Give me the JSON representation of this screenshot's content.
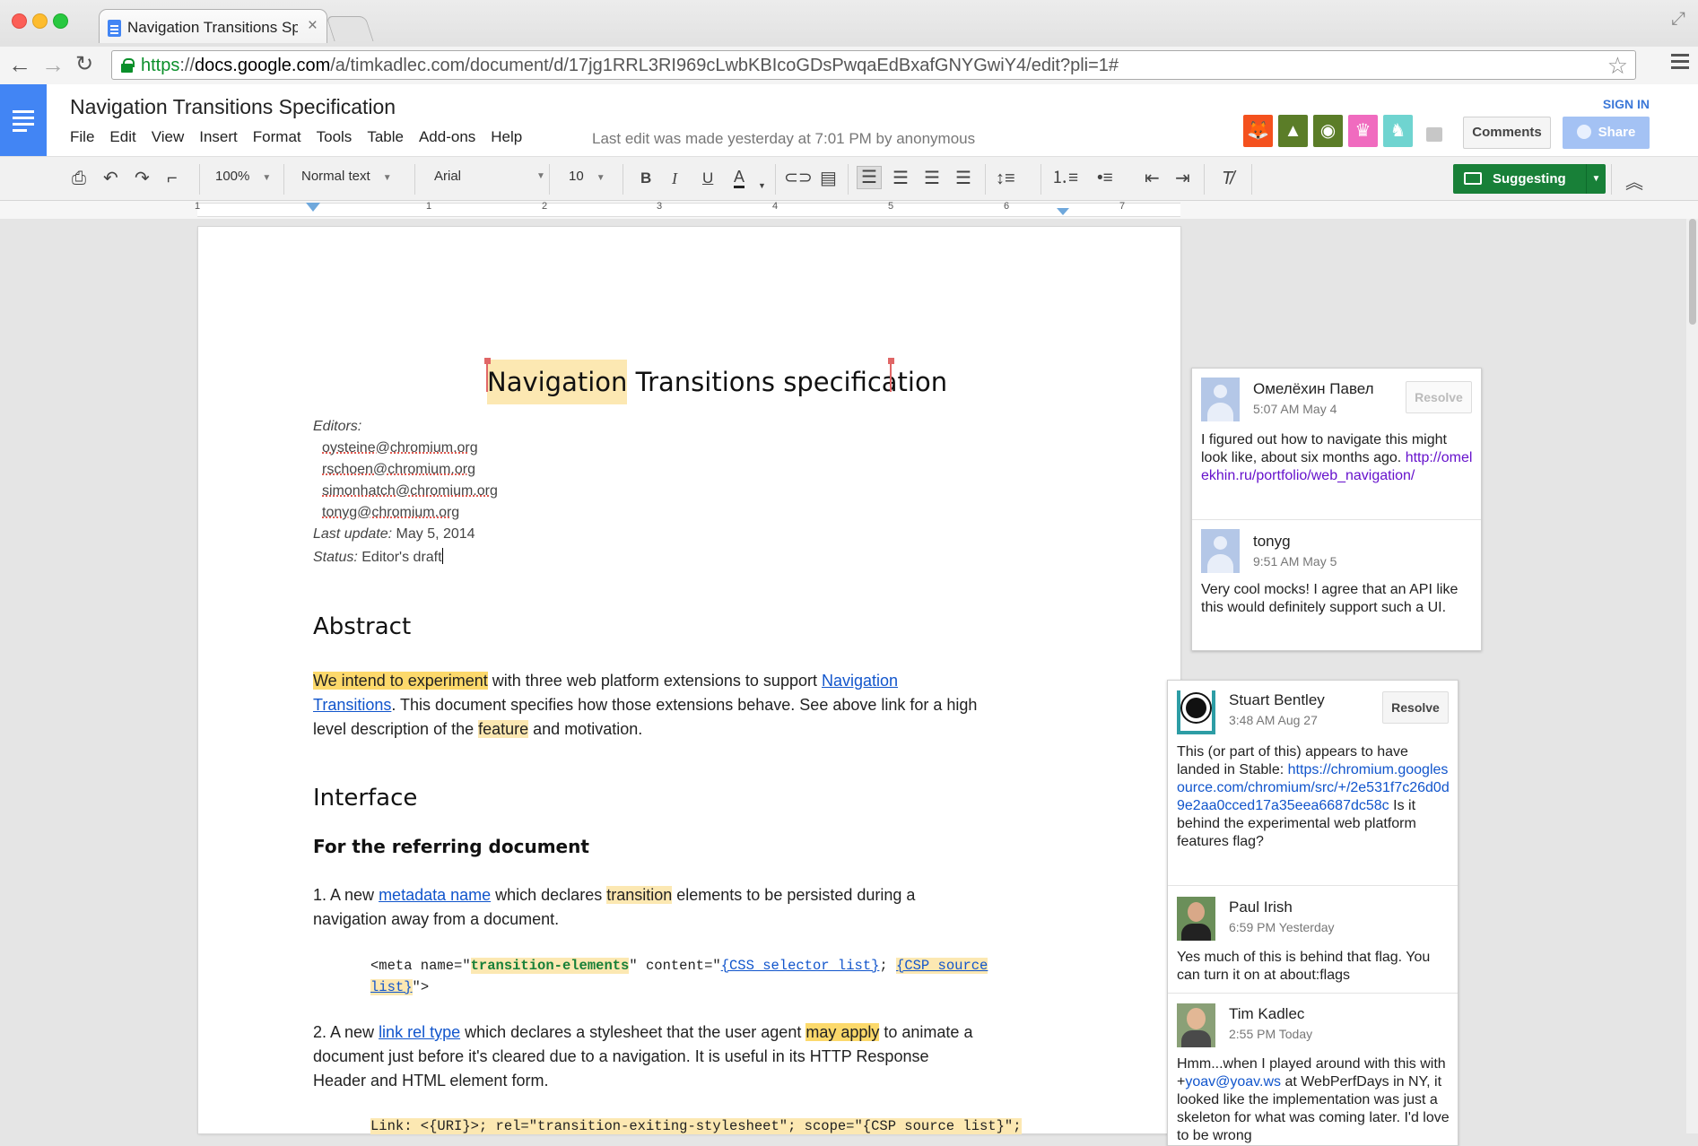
{
  "browser": {
    "tab_title": "Navigation Transitions Spe",
    "tab_close": "×",
    "url_scheme": "https",
    "url_host": "docs.google.com",
    "url_rest": "/a/timkadlec.com/document/d/17jg1RRL3RI969cLwbKBIcoGDsPwqaEdBxafGNYGwiY4/edit?pli=1#"
  },
  "docs": {
    "title": "Navigation Transitions Specification",
    "menu": [
      "File",
      "Edit",
      "View",
      "Insert",
      "Format",
      "Tools",
      "Table",
      "Add-ons",
      "Help"
    ],
    "last_edit": "Last edit was made yesterday at 7:01 PM by anonymous",
    "sign_in": "SIGN IN",
    "comments_label": "Comments",
    "share_label": "Share",
    "collaborator_colors": [
      "#f4511e",
      "#5b7d28",
      "#5b7d28",
      "#f06bbf",
      "#6fd4d0"
    ]
  },
  "toolbar": {
    "zoom": "100%",
    "style": "Normal text",
    "font": "Arial",
    "font_size": "10",
    "bold": "B",
    "italic": "I",
    "underline": "U",
    "text_color": "A",
    "suggesting_label": "Suggesting"
  },
  "ruler": {
    "numbers": [
      "1",
      "1",
      "2",
      "3",
      "4",
      "5",
      "6",
      "7"
    ]
  },
  "document": {
    "title_a": "Navigation",
    "title_b": " Transitions specification",
    "editors_label": "Editors:",
    "editors": [
      "oysteine@chromium.org",
      "rschoen@chromium.org",
      "simonhatch@chromium.org",
      "tonyg@chromium.org"
    ],
    "last_update_label": "Last update:",
    "last_update_value": " May 5, 2014",
    "status_label": "Status:",
    "status_value": " Editor's draft",
    "abstract_heading": "Abstract",
    "abstract_p1_hl": "We intend to experiment",
    "abstract_p1_a": " with three web platform extensions to support ",
    "abstract_p1_link": "Navigation",
    "abstract_p2_link": "Transitions",
    "abstract_p2_rest": ". This document specifies how those extensions behave. See above link for a high",
    "abstract_p3_a": "level description of the ",
    "abstract_p3_hl": "feature",
    "abstract_p3_b": " and motivation.",
    "interface_heading": "Interface",
    "referring_heading": "For the referring document",
    "item1_a": "1. A new ",
    "item1_link": "metadata name",
    "item1_b": " which declares ",
    "item1_hl": "transition",
    "item1_c": " elements to be persisted during a",
    "item1_line2": "navigation away from a document.",
    "code1_a": "<meta name=\"",
    "code1_s": "transition-elements",
    "code1_b": "\" content=\"",
    "code1_v1": "{CSS selector list}",
    "code1_c": "; ",
    "code1_v2": "{CSP source",
    "code1_line2_v": "list}",
    "code1_line2_b": "\">",
    "item2_a": "2. A new ",
    "item2_link": "link rel type",
    "item2_b": " which declares a stylesheet that the user agent ",
    "item2_hl": "may apply",
    "item2_c": " to animate a",
    "item2_line2": "document just before it's cleared due to a navigation. It is useful in its HTTP Response",
    "item2_line3": "Header and HTML element form.",
    "code2": "Link: <{URI}>; rel=\"transition-exiting-stylesheet\"; scope=\"{CSP source list}\";"
  },
  "comments": [
    {
      "thread": [
        {
          "name": "Омелёхин Павел",
          "time": "5:07 AM May 4",
          "body": "I figured out how to navigate this might look like, about six months ago.",
          "link": "http://omelekhin.ru/portfolio/web_navigation/"
        },
        {
          "name": "tonyg",
          "time": "9:51 AM May 5",
          "body": "Very cool mocks! I agree that an API like this would definitely support such a UI."
        }
      ],
      "resolve": "Resolve"
    },
    {
      "thread": [
        {
          "name": "Stuart Bentley",
          "time": "3:48 AM Aug 27",
          "body_a": "This (or part of this) appears to have landed in Stable:",
          "link": "https://chromium.googlesource.com/chromium/src/+/2e531f7c26d0d9e2aa0cced17a35eea6687dc58c",
          "body_b": " Is it behind the experimental web platform features flag?"
        },
        {
          "name": "Paul Irish",
          "time": "6:59 PM Yesterday",
          "body": "Yes much of this is behind that flag. You can turn it on at about:flags"
        },
        {
          "name": "Tim Kadlec",
          "time": "2:55 PM Today",
          "body_a": "Hmm...when I played around with this with +",
          "mention": "yoav@yoav.ws",
          "body_b": " at WebPerfDays in NY, it looked like the implementation was just a skeleton for what was coming later. I'd love to be wrong"
        }
      ],
      "resolve": "Resolve"
    }
  ]
}
